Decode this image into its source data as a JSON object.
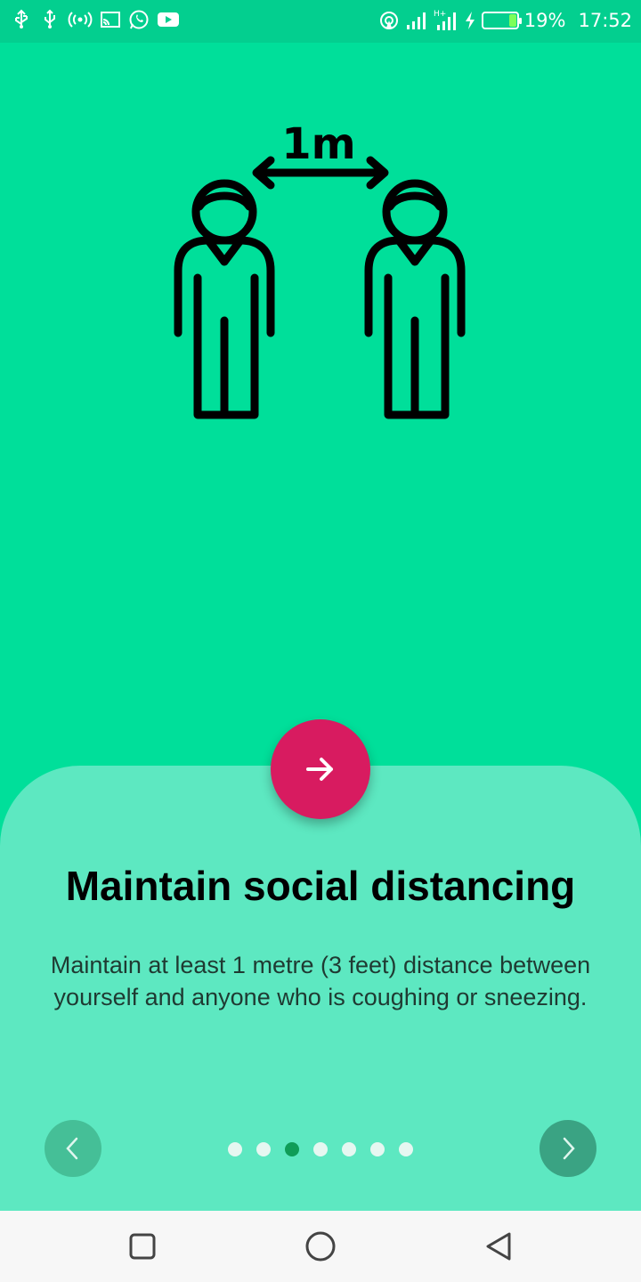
{
  "status_bar": {
    "left_icons": [
      "usb-icon",
      "usb-icon",
      "hotspot-icon",
      "cast-icon",
      "whatsapp-icon",
      "youtube-icon"
    ],
    "right_icons": [
      "wifi-hotspot-icon",
      "signal-icon",
      "hplus-signal-icon",
      "charging-icon",
      "battery-icon"
    ],
    "battery": "19%",
    "time": "17:52",
    "battery_level": 0.19
  },
  "hero": {
    "illustration": "social-distancing-illustration",
    "distance_label": "1m",
    "background": "#00df9a"
  },
  "onboarding": {
    "title": "Maintain social distancing",
    "description": "Maintain at least 1 metre (3 feet) distance between yourself and anyone who is coughing or sneezing.",
    "fab_icon": "arrow-right-icon",
    "prev_icon": "chevron-left-icon",
    "next_icon": "chevron-right-icon",
    "page_count": 7,
    "active_page": 3,
    "panel_color": "#5de8c1",
    "accent": "#d81b60",
    "active_dot_color": "#0f9d58"
  },
  "system_nav": {
    "buttons": [
      "recents-icon",
      "home-icon",
      "back-icon"
    ]
  }
}
